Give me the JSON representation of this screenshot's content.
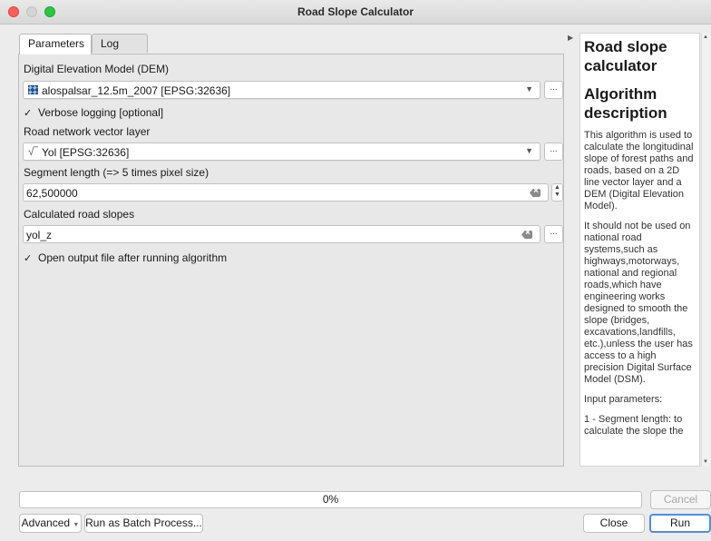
{
  "window": {
    "title": "Road Slope Calculator"
  },
  "tabs": [
    {
      "label": "Parameters",
      "active": true
    },
    {
      "label": "Log",
      "active": false
    }
  ],
  "params": {
    "dem_label": "Digital Elevation Model (DEM)",
    "dem_value": "alospalsar_12.5m_2007 [EPSG:32636]",
    "verbose_label": "Verbose logging [optional]",
    "verbose_checked": true,
    "road_label": "Road network vector layer",
    "road_value": "Yol [EPSG:32636]",
    "segment_label": "Segment length (=> 5 times pixel size)",
    "segment_value": "62,500000",
    "output_label": "Calculated road slopes",
    "output_value": "yol_z",
    "open_label": "Open output file after running algorithm",
    "open_checked": true,
    "check_mark": "✓",
    "dots": "...",
    "combo_arrow": "▼"
  },
  "help": {
    "title": "Road slope calculator",
    "section": "Algorithm description",
    "p1": "This algorithm is used to calculate the longitudinal slope of forest paths and roads, based on a 2D line vector layer and a DEM (Digital Elevation Model).",
    "p2": "It should not be used on national road systems,such as highways,motorways, national and regional roads,which have engineering works designed to smooth the slope (bridges, excavations,landfills, etc.),unless the user has access to a high precision Digital Surface Model (DSM).",
    "p3": "Input parameters:",
    "p4": "1 - Segment length: to calculate the slope the"
  },
  "footer": {
    "progress_text": "0%",
    "progress_value": 0,
    "cancel": "Cancel",
    "advanced": "Advanced",
    "batch": "Run as Batch Process...",
    "close": "Close",
    "run": "Run"
  },
  "colors": {
    "accent": "#4b90e6",
    "close": "#ff5f57",
    "max": "#28c840"
  }
}
